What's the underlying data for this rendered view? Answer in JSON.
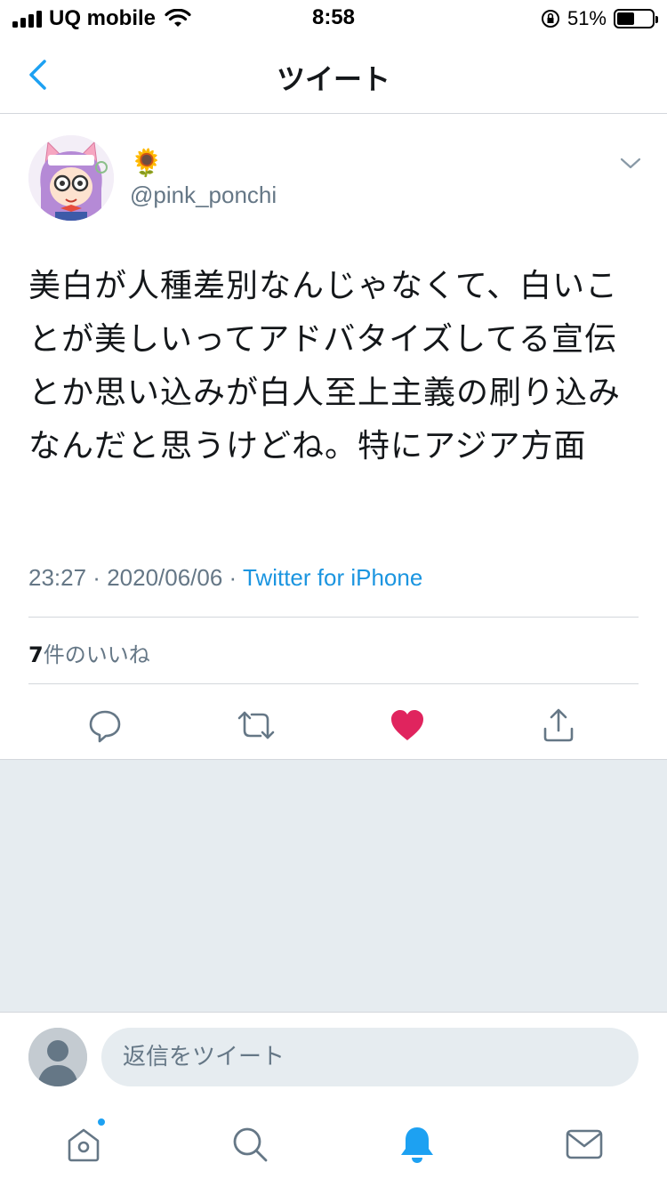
{
  "status_bar": {
    "carrier": "UQ mobile",
    "time": "8:58",
    "battery_percent": "51%",
    "battery_level": 0.51
  },
  "nav": {
    "title": "ツイート",
    "back_icon": "chevron-left-icon"
  },
  "tweet": {
    "display_name": "🌻",
    "handle": "@pink_ponchi",
    "text": "美白が人種差別なんじゃなくて、白いことが美しいってアドバタイズしてる宣伝とか思い込みが白人至上主義の刷り込みなんだと思うけどね。特にアジア方面",
    "time": "23:27",
    "separator": " · ",
    "date": "2020/06/06",
    "source": "Twitter for iPhone",
    "likes_count": "7",
    "likes_label": "件のいいね"
  },
  "reply": {
    "placeholder": "返信をツイート"
  },
  "colors": {
    "accent": "#1da1f2",
    "like": "#e0245e",
    "secondary_text": "#657786",
    "background_gray": "#e6ecf0"
  }
}
